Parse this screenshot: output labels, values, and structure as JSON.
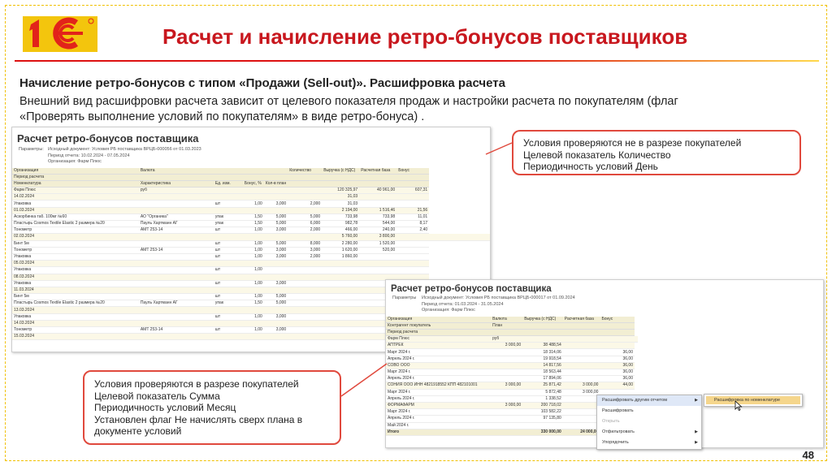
{
  "header": {
    "logo_text": "1С",
    "title": "Расчет и начисление ретро-бонусов поставщиков"
  },
  "intro": {
    "subheading": "Начисление ретро-бонусов с типом «Продажи (Sell-out)». Расшифровка расчета",
    "line1": "Внешний вид расшифровки расчета зависит от целевого показателя продаж и настройки расчета по покупателям (флаг",
    "line2": "«Проверять выполнение условий по покупателям» в виде ретро-бонуса) ."
  },
  "report1": {
    "title": "Расчет ретро-бонусов поставщика",
    "params": [
      {
        "label": "Параметры:",
        "value": "Исходный документ: Условия РБ поставщика ВРЦБ-000056 от 01.03.2023"
      },
      {
        "label": "",
        "value": "Период отчета: 10.02.2024 - 07.05.2024"
      },
      {
        "label": "",
        "value": "Организация: Фарм Плюс"
      }
    ],
    "header_rows": [
      [
        "Организация",
        "",
        "Валюта",
        "",
        "",
        "",
        "Количество",
        "Выручка (с НДС)",
        "Расчетная база",
        "Бонус"
      ],
      [
        "Период расчета",
        "",
        "",
        "",
        "",
        "",
        "",
        "",
        "",
        ""
      ],
      [
        "Номенклатура",
        "",
        "Характеристика",
        "Ед. изм.",
        "Бонус, %",
        "Кол-в план",
        "",
        "",
        "",
        ""
      ]
    ],
    "rows": [
      {
        "type": "grp",
        "cells": [
          "Фарм Плюс",
          "",
          "руб",
          "",
          "",
          "",
          "",
          "120 325,97",
          "40 961,00",
          "607,31"
        ]
      },
      {
        "type": "grp",
        "cells": [
          "14.02.2024",
          "",
          "",
          "",
          "",
          "",
          "",
          "31,03",
          "",
          ""
        ]
      },
      {
        "type": "row",
        "cells": [
          "Упаковка",
          "",
          "",
          "шт",
          "1,00",
          "3,000",
          "2,000",
          "31,03",
          "",
          ""
        ]
      },
      {
        "type": "grp",
        "cells": [
          "01.03.2024",
          "",
          "",
          "",
          "",
          "",
          "",
          "2 194,00",
          "1 516,46",
          "21,56"
        ]
      },
      {
        "type": "row",
        "cells": [
          "Аскорбинка таб. 100мг №60",
          "",
          "АО \"Органика\"",
          "упак",
          "1,50",
          "5,000",
          "5,000",
          "733,98",
          "733,98",
          "11,01"
        ]
      },
      {
        "type": "row",
        "cells": [
          "Пластырь Cosmos Textile Elastic 2 размера №20",
          "",
          "Пауль Хартманн АГ",
          "упак",
          "1,50",
          "5,000",
          "6,000",
          "982,78",
          "544,00",
          "8,17"
        ]
      },
      {
        "type": "row",
        "cells": [
          "Тонометр",
          "",
          "AMT 253-14",
          "шт",
          "1,00",
          "3,000",
          "2,000",
          "466,00",
          "240,00",
          "2,40"
        ]
      },
      {
        "type": "grp",
        "cells": [
          "02.03.2024",
          "",
          "",
          "",
          "",
          "",
          "",
          "5 760,00",
          "3 800,00",
          "",
          ""
        ]
      },
      {
        "type": "row",
        "cells": [
          "Бинт 5м",
          "",
          "",
          "шт",
          "1,00",
          "5,000",
          "8,000",
          "2 280,00",
          "1 520,00",
          ""
        ]
      },
      {
        "type": "row",
        "cells": [
          "Тонометр",
          "",
          "AMT 253-14",
          "шт",
          "1,00",
          "3,000",
          "3,000",
          "1 620,00",
          "520,00",
          ""
        ]
      },
      {
        "type": "row",
        "cells": [
          "Упаковка",
          "",
          "",
          "шт",
          "1,00",
          "3,000",
          "2,000",
          "1 860,00",
          "",
          ""
        ]
      },
      {
        "type": "grp",
        "cells": [
          "05.03.2024",
          "",
          "",
          "",
          "",
          "",
          "",
          "",
          "",
          ""
        ]
      },
      {
        "type": "row",
        "cells": [
          "Упаковка",
          "",
          "",
          "шт",
          "1,00",
          "",
          "",
          "",
          "",
          ""
        ]
      },
      {
        "type": "grp",
        "cells": [
          "08.03.2024",
          "",
          "",
          "",
          "",
          "",
          "",
          "",
          "",
          ""
        ]
      },
      {
        "type": "row",
        "cells": [
          "Упаковка",
          "",
          "",
          "шт",
          "1,00",
          "3,000",
          "",
          "",
          "",
          ""
        ]
      },
      {
        "type": "grp",
        "cells": [
          "11.03.2024",
          "",
          "",
          "",
          "",
          "",
          "",
          "",
          "",
          ""
        ]
      },
      {
        "type": "row",
        "cells": [
          "Бинт 5м",
          "",
          "",
          "шт",
          "1,00",
          "5,000",
          "",
          "",
          "",
          ""
        ]
      },
      {
        "type": "row",
        "cells": [
          "Пластырь Cosmos Textile Elastic 2 размера №20",
          "",
          "Пауль Хартманн АГ",
          "упак",
          "1,50",
          "5,000",
          "",
          "",
          "",
          ""
        ]
      },
      {
        "type": "grp",
        "cells": [
          "13.03.2024",
          "",
          "",
          "",
          "",
          "",
          "",
          "",
          "",
          ""
        ]
      },
      {
        "type": "row",
        "cells": [
          "Упаковка",
          "",
          "",
          "шт",
          "1,00",
          "3,000",
          "",
          "",
          "",
          ""
        ]
      },
      {
        "type": "grp",
        "cells": [
          "14.03.2024",
          "",
          "",
          "",
          "",
          "",
          "",
          "",
          "",
          ""
        ]
      },
      {
        "type": "row",
        "cells": [
          "Тонометр",
          "",
          "AMT 253-14",
          "шт",
          "1,00",
          "3,000",
          "",
          "",
          "",
          ""
        ]
      },
      {
        "type": "grp",
        "cells": [
          "15.03.2024",
          "",
          "",
          "",
          "",
          "",
          "",
          "",
          "",
          ""
        ]
      }
    ]
  },
  "report2": {
    "title": "Расчет ретро-бонусов поставщика",
    "params": [
      {
        "label": "Параметры",
        "value": "Исходный документ: Условия РБ поставщика ВРЦБ-000017 от 01.09.2024"
      },
      {
        "label": "",
        "value": "Период отчета: 01.03.2024 - 31.05.2024"
      },
      {
        "label": "",
        "value": "Организация: Фарм Плюс"
      }
    ],
    "header_rows": [
      [
        "Организация",
        "Валюта",
        "Выручка (с НДС)",
        "Расчетная база",
        "Бонус"
      ],
      [
        "Контрагент покупатель",
        "План",
        "",
        "",
        ""
      ],
      [
        "Период расчета",
        "",
        "",
        "",
        ""
      ]
    ],
    "rows": [
      {
        "type": "grp",
        "cells": [
          "Фарм Плюс",
          "руб",
          "",
          "",
          "",
          ""
        ]
      },
      {
        "type": "grp",
        "cells": [
          "АПТРЕК",
          "3 000,00",
          "38 488,54",
          "",
          ""
        ]
      },
      {
        "type": "row",
        "cells": [
          "Март 2024 г.",
          "",
          "18 314,06",
          "",
          "36,00"
        ]
      },
      {
        "type": "row",
        "cells": [
          "Апрель 2024 г.",
          "",
          "19 918,54",
          "",
          "36,00"
        ]
      },
      {
        "type": "grp",
        "cells": [
          "СОВО ООО",
          "",
          "14 817,56",
          "",
          "36,00"
        ]
      },
      {
        "type": "row",
        "cells": [
          "Март 2024 г.",
          "",
          "18 563,44",
          "",
          "36,00"
        ]
      },
      {
        "type": "row",
        "cells": [
          "Апрель 2024 г.",
          "",
          "17 894,06",
          "",
          "36,00"
        ]
      },
      {
        "type": "grp",
        "cells": [
          "СОНИЯ ООО ИНН 4821918552 КПП 482101001",
          "3 000,00",
          "25 871,42",
          "3 000,00",
          "44,00"
        ]
      },
      {
        "type": "row",
        "cells": [
          "Март 2024 г.",
          "",
          "5 872,48",
          "3 000,00",
          "",
          ""
        ]
      },
      {
        "type": "row",
        "cells": [
          "Апрель 2024 г.",
          "",
          "1 338,52",
          "",
          ""
        ]
      },
      {
        "type": "grp",
        "cells": [
          "ФОРМАФАРМ",
          "3 000,00",
          "200 718,02",
          "",
          ""
        ]
      },
      {
        "type": "row",
        "cells": [
          "Март 2024 г.",
          "",
          "103 582,22",
          "",
          ""
        ]
      },
      {
        "type": "row",
        "cells": [
          "Апрель 2024 г.",
          "",
          "97 135,80",
          "",
          ""
        ]
      },
      {
        "type": "row",
        "cells": [
          "Май 2024 г.",
          "",
          "",
          "",
          ""
        ]
      }
    ],
    "total": [
      "Итого",
      "",
      "330 000,00",
      "24 000,00",
      ""
    ]
  },
  "context_menu": {
    "items": [
      {
        "label": "Расшифровать другим отчетом",
        "has_submenu": true,
        "state": "active"
      },
      {
        "label": "Расшифровать",
        "has_submenu": false,
        "state": "normal"
      },
      {
        "label": "Открыть",
        "has_submenu": false,
        "state": "disabled"
      },
      {
        "label": "Отфильтровать",
        "has_submenu": true,
        "state": "normal"
      },
      {
        "label": "Упорядочить",
        "has_submenu": true,
        "state": "normal"
      }
    ],
    "submenu_item": "Расшифровка по номенклатуре"
  },
  "callout_top": {
    "lines": [
      "Условия проверяются не в разрезе покупателей",
      "Целевой показатель Количество",
      "Периодичность условий День"
    ]
  },
  "callout_bottom": {
    "lines": [
      "Условия проверяются в разрезе покупателей",
      "Целевой показатель Сумма",
      "Периодичность условий Месяц",
      "Установлен флаг Не начислять сверх плана в",
      "документе условий"
    ]
  },
  "footer": {
    "page_number": "48"
  },
  "colors": {
    "accent_red": "#c8171e",
    "callout_border": "#e0493d",
    "logo_red": "#e2231a",
    "logo_yellow": "#f2c200",
    "menu_highlight": "#f5d68c"
  }
}
